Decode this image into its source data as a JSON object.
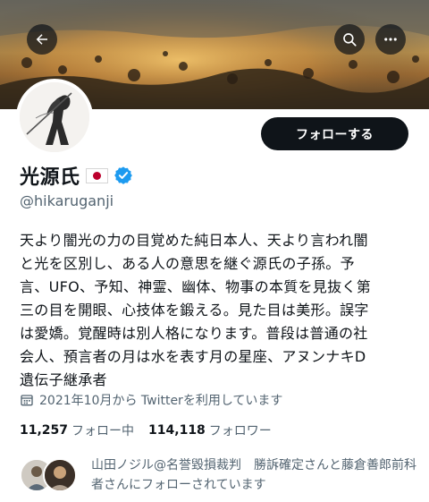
{
  "profile": {
    "display_name": "光源氏",
    "handle": "@hikaruganji",
    "bio": "天より闇光の力の目覚めた純日本人、天より言われ闇\nと光を区別し、ある人の意思を継ぐ源氏の子孫。予\n言、UFO、予知、神霊、幽体、物事の本質を見抜く第\n三の目を開眼、心技体を鍛える。見た目は美形。誤字\nは愛嬌。覚醒時は別人格になります。普段は普通の社\n会人、預言者の月は水を表す月の星座、アヌンナキD\n遺伝子継承者",
    "joined": "2021年10月から Twitterを利用しています",
    "verified": true,
    "flag_icon": "japan-flag-icon"
  },
  "header": {
    "back_icon": "arrow-left-icon",
    "search_icon": "search-icon",
    "more_icon": "more-horizontal-icon"
  },
  "actions": {
    "follow_label": "フォローする"
  },
  "stats": {
    "following_count": "11,257",
    "following_label": "フォロー中",
    "followers_count": "114,118",
    "followers_label": "フォロワー"
  },
  "followed_by": {
    "text": "山田ノジル@名誉毀損裁判　勝訴確定さんと藤倉善郎前科者さんにフォローされています"
  },
  "colors": {
    "primary_text": "#0f1419",
    "secondary_text": "#536471",
    "verified_blue": "#1d9bf0",
    "button_dark": "#0f1419",
    "flag_red": "#bc002d"
  }
}
